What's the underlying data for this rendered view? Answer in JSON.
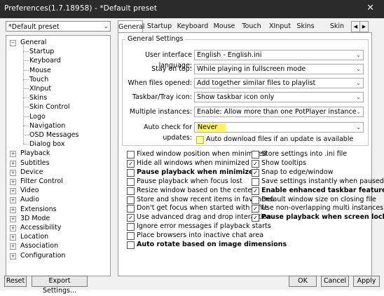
{
  "window": {
    "title": "Preferences(1.7.18958) - *Default preset",
    "close": "✕"
  },
  "preset": {
    "value": "*Default preset"
  },
  "tree": {
    "general": "General",
    "general_children": [
      "Startup",
      "Keyboard",
      "Mouse",
      "Touch",
      "XInput",
      "Skins",
      "Skin Control",
      "Logo",
      "Navigation",
      "OSD Messages",
      "Dialog box"
    ],
    "top_items": [
      "Playback",
      "Subtitles",
      "Device",
      "Filter Control",
      "Video",
      "Audio",
      "Extensions",
      "3D Mode",
      "Accessibility",
      "Location",
      "Association",
      "Configuration"
    ]
  },
  "tabs": [
    "General",
    "Startup",
    "Keyboard",
    "Mouse",
    "Touch",
    "XInput",
    "Skins",
    "Skin Control"
  ],
  "tab_scroll": {
    "left": "◀",
    "right": "▶"
  },
  "general_settings": {
    "title": "General Settings",
    "rows": [
      {
        "label": "User interface language:",
        "value": "English - English.ini"
      },
      {
        "label": "Stay on top:",
        "value": "While playing in fullscreen mode"
      },
      {
        "label": "When files opened:",
        "value": "Add together similar files to playlist"
      },
      {
        "label": "Taskbar/Tray icon:",
        "value": "Show taskbar icon only"
      },
      {
        "label": "Multiple instances:",
        "value": "Enable: Allow more than one PotPlayer instance"
      },
      {
        "label": "Auto check for updates:",
        "value": "Never"
      }
    ],
    "auto_download": {
      "label": "Auto download files if an update is available",
      "checked": false
    }
  },
  "options_left": [
    {
      "label": "Fixed window position when minimized",
      "checked": false,
      "bold": false
    },
    {
      "label": "Hide all windows when minimized",
      "checked": true,
      "bold": false
    },
    {
      "label": "Pause playback when minimized",
      "checked": false,
      "bold": true
    },
    {
      "label": "Pause playback when focus lost",
      "checked": false,
      "bold": false
    },
    {
      "label": "Resize window based on the center",
      "checked": false,
      "bold": false
    },
    {
      "label": "Store and show recent items in fav menu",
      "checked": false,
      "bold": false
    },
    {
      "label": "Don't get focus when started with a file",
      "checked": false,
      "bold": false
    },
    {
      "label": "Use advanced drag and drop interaction",
      "checked": true,
      "bold": false
    },
    {
      "label": "Ignore error messages if playback starts",
      "checked": false,
      "bold": false
    },
    {
      "label": "Place browsers into inactive chat area",
      "checked": false,
      "bold": false
    },
    {
      "label": "Auto rotate based on image dimensions",
      "checked": false,
      "bold": true
    }
  ],
  "options_right": [
    {
      "label": "Store settings into .ini file",
      "checked": false,
      "bold": false
    },
    {
      "label": "Show tooltips",
      "checked": true,
      "bold": false
    },
    {
      "label": "Snap to edge/window",
      "checked": true,
      "bold": false
    },
    {
      "label": "Save settings instantly when paused",
      "checked": false,
      "bold": false
    },
    {
      "label": "Enable enhanced taskbar features",
      "checked": true,
      "bold": true
    },
    {
      "label": "Default window size on closing file",
      "checked": false,
      "bold": false
    },
    {
      "label": "Use non-overlapping multi instances",
      "checked": true,
      "bold": false
    },
    {
      "label": "Pause playback when screen locked",
      "checked": true,
      "bold": true
    }
  ],
  "buttons": {
    "reset": "Reset",
    "export": "Export Settings...",
    "ok": "OK",
    "cancel": "Cancel",
    "apply": "Apply"
  },
  "check_mark": "✓",
  "combo_arrow": "⌄",
  "colors": {
    "titlebar": "#2b2b2b",
    "highlight": "#fff35a"
  }
}
